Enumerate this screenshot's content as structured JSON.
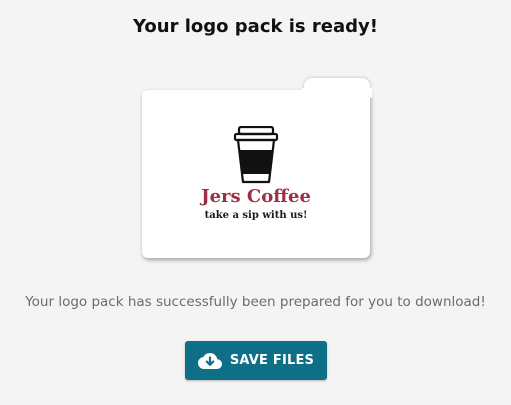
{
  "header": {
    "title": "Your logo pack is ready!"
  },
  "preview": {
    "icon": "coffee-cup-icon",
    "brand_name": "Jers Coffee",
    "tagline": "take a sip with us!",
    "brand_color": "#9e2f45"
  },
  "message": "Your logo pack has successfully been prepared for you to download!",
  "actions": {
    "save_label": "SAVE FILES",
    "save_icon": "cloud-download-icon",
    "button_color": "#0e6f87"
  }
}
